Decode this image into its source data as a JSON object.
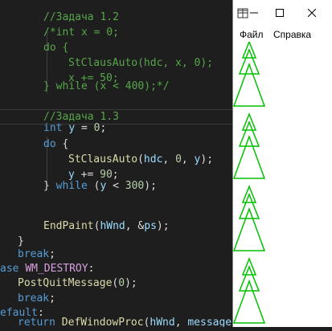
{
  "editor": {
    "lines": [
      {
        "indent": "    ",
        "tokens": [
          {
            "c": "comment",
            "t": "//Задача 1.2"
          }
        ]
      },
      {
        "indent": "    ",
        "tokens": [
          {
            "c": "comment",
            "t": "/*int x = 0;"
          }
        ]
      },
      {
        "indent": "    ",
        "tokens": [
          {
            "c": "comment",
            "t": "do {"
          }
        ]
      },
      {
        "indent": "        ",
        "tokens": [
          {
            "c": "comment",
            "t": "StClausAuto(hdc, x, 0);"
          }
        ]
      },
      {
        "indent": "        ",
        "tokens": [
          {
            "c": "comment",
            "t": "x += 50;"
          }
        ]
      },
      {
        "indent": "    ",
        "tokens": [
          {
            "c": "comment",
            "t": "} while (x < 400);*/"
          }
        ]
      },
      {
        "indent": "",
        "tokens": []
      },
      {
        "indent": "    ",
        "tokens": [
          {
            "c": "comment",
            "t": "//Задача 1.3"
          }
        ]
      },
      {
        "indent": "    ",
        "tokens": [
          {
            "c": "kw",
            "t": "int"
          },
          {
            "c": "plain",
            "t": " "
          },
          {
            "c": "var",
            "t": "y"
          },
          {
            "c": "plain",
            "t": " = "
          },
          {
            "c": "num",
            "t": "0"
          },
          {
            "c": "plain",
            "t": ";"
          }
        ]
      },
      {
        "indent": "    ",
        "tokens": [
          {
            "c": "kw",
            "t": "do"
          },
          {
            "c": "plain",
            "t": " {"
          }
        ]
      },
      {
        "indent": "        ",
        "tokens": [
          {
            "c": "fn",
            "t": "StClausAuto"
          },
          {
            "c": "plain",
            "t": "("
          },
          {
            "c": "var",
            "t": "hdc"
          },
          {
            "c": "plain",
            "t": ", "
          },
          {
            "c": "num",
            "t": "0"
          },
          {
            "c": "plain",
            "t": ", "
          },
          {
            "c": "var",
            "t": "y"
          },
          {
            "c": "plain",
            "t": ");"
          }
        ]
      },
      {
        "indent": "        ",
        "tokens": [
          {
            "c": "var",
            "t": "y"
          },
          {
            "c": "plain",
            "t": " += "
          },
          {
            "c": "num",
            "t": "90"
          },
          {
            "c": "plain",
            "t": ";"
          }
        ]
      },
      {
        "indent": "    ",
        "tokens": [
          {
            "c": "plain",
            "t": "} "
          },
          {
            "c": "kw",
            "t": "while"
          },
          {
            "c": "plain",
            "t": " ("
          },
          {
            "c": "var",
            "t": "y"
          },
          {
            "c": "plain",
            "t": " < "
          },
          {
            "c": "num",
            "t": "300"
          },
          {
            "c": "plain",
            "t": ");"
          }
        ]
      },
      {
        "indent": "",
        "tokens": []
      },
      {
        "indent": "",
        "tokens": []
      },
      {
        "indent": "    ",
        "tokens": [
          {
            "c": "fn",
            "t": "EndPaint"
          },
          {
            "c": "plain",
            "t": "("
          },
          {
            "c": "var",
            "t": "hWnd"
          },
          {
            "c": "plain",
            "t": ", &"
          },
          {
            "c": "var",
            "t": "ps"
          },
          {
            "c": "plain",
            "t": ");"
          }
        ]
      },
      {
        "indent": "",
        "tokens": [
          {
            "c": "plain",
            "t": "}"
          }
        ]
      },
      {
        "indent": "",
        "tokens": [
          {
            "c": "kw",
            "t": "break"
          },
          {
            "c": "plain",
            "t": ";"
          }
        ]
      },
      {
        "indent": "",
        "tokens": [
          {
            "c": "kw",
            "t": "ase"
          },
          {
            "c": "plain",
            "t": " "
          },
          {
            "c": "purple",
            "t": "WM_DESTROY"
          },
          {
            "c": "plain",
            "t": ":"
          }
        ]
      },
      {
        "indent": "",
        "tokens": [
          {
            "c": "fn",
            "t": "PostQuitMessage"
          },
          {
            "c": "plain",
            "t": "("
          },
          {
            "c": "num",
            "t": "0"
          },
          {
            "c": "plain",
            "t": ");"
          }
        ]
      },
      {
        "indent": "",
        "tokens": [
          {
            "c": "kw",
            "t": "break"
          },
          {
            "c": "plain",
            "t": ";"
          }
        ]
      },
      {
        "indent": "",
        "tokens": [
          {
            "c": "kw",
            "t": "efault"
          },
          {
            "c": "plain",
            "t": ":"
          }
        ]
      },
      {
        "indent": "",
        "tokens": [
          {
            "c": "kw",
            "t": "return"
          },
          {
            "c": "plain",
            "t": " "
          },
          {
            "c": "fn",
            "t": "DefWindowProc"
          },
          {
            "c": "plain",
            "t": "("
          },
          {
            "c": "var",
            "t": "hWnd"
          },
          {
            "c": "plain",
            "t": ", "
          },
          {
            "c": "var",
            "t": "message"
          },
          {
            "c": "plain",
            "t": ","
          }
        ]
      }
    ]
  },
  "window": {
    "menu": [
      "Файл",
      "Справка"
    ],
    "controls": {
      "minimize": "–",
      "maximize": "☐",
      "close": "✕"
    },
    "tree_color": "#00c000",
    "trees": 4
  },
  "colors": {
    "comment": "#57a64a",
    "kw": "#569cd6",
    "fn": "#dcdcaa",
    "var": "#9cdcfe",
    "num": "#b5cea8",
    "plain": "#dcdcdc",
    "purple": "#d8a0df"
  }
}
